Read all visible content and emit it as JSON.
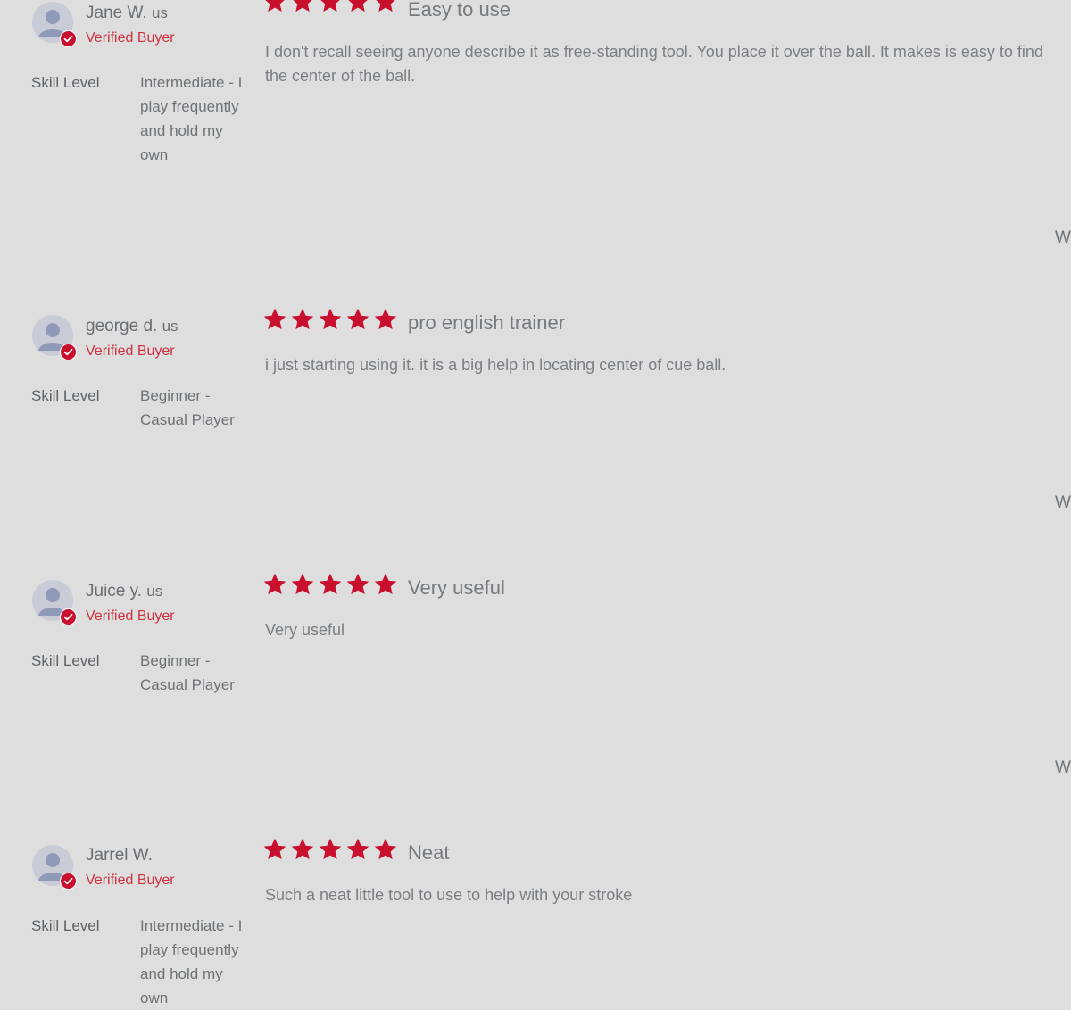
{
  "colors": {
    "background": "#dedede",
    "star": "#c8102e",
    "verified": "#d0313f",
    "avatar_bg": "#c9ccd6",
    "avatar_figure": "#8e9ab7"
  },
  "icons": {
    "avatar": "user-avatar-icon",
    "verified_badge": "check-circle-icon",
    "star": "star-icon"
  },
  "reviews": [
    {
      "name": "Jane W.",
      "country": "us",
      "verified": "Verified Buyer",
      "skill_label": "Skill Level",
      "skill_value": "Intermediate - I play frequently and hold my own",
      "rating": 5,
      "title": "Easy to use",
      "body": "I don't recall seeing anyone describe it as free-standing tool. You place it over the ball. It makes is easy to find the center of the ball.",
      "side_text": "W"
    },
    {
      "name": "george d.",
      "country": "us",
      "verified": "Verified Buyer",
      "skill_label": "Skill Level",
      "skill_value": "Beginner - Casual Player",
      "rating": 5,
      "title": "pro english trainer",
      "body": "i just starting using it. it is a big help in locating center of cue ball.",
      "side_text": "W"
    },
    {
      "name": "Juice y.",
      "country": "us",
      "verified": "Verified Buyer",
      "skill_label": "Skill Level",
      "skill_value": "Beginner - Casual Player",
      "rating": 5,
      "title": "Very useful",
      "body": "Very useful",
      "side_text": "W"
    },
    {
      "name": "Jarrel W.",
      "country": "",
      "verified": "Verified Buyer",
      "skill_label": "Skill Level",
      "skill_value": "Intermediate - I play frequently and hold my own",
      "rating": 5,
      "title": "Neat",
      "body": "Such a neat little tool to use to help with your stroke",
      "side_text": ""
    }
  ]
}
